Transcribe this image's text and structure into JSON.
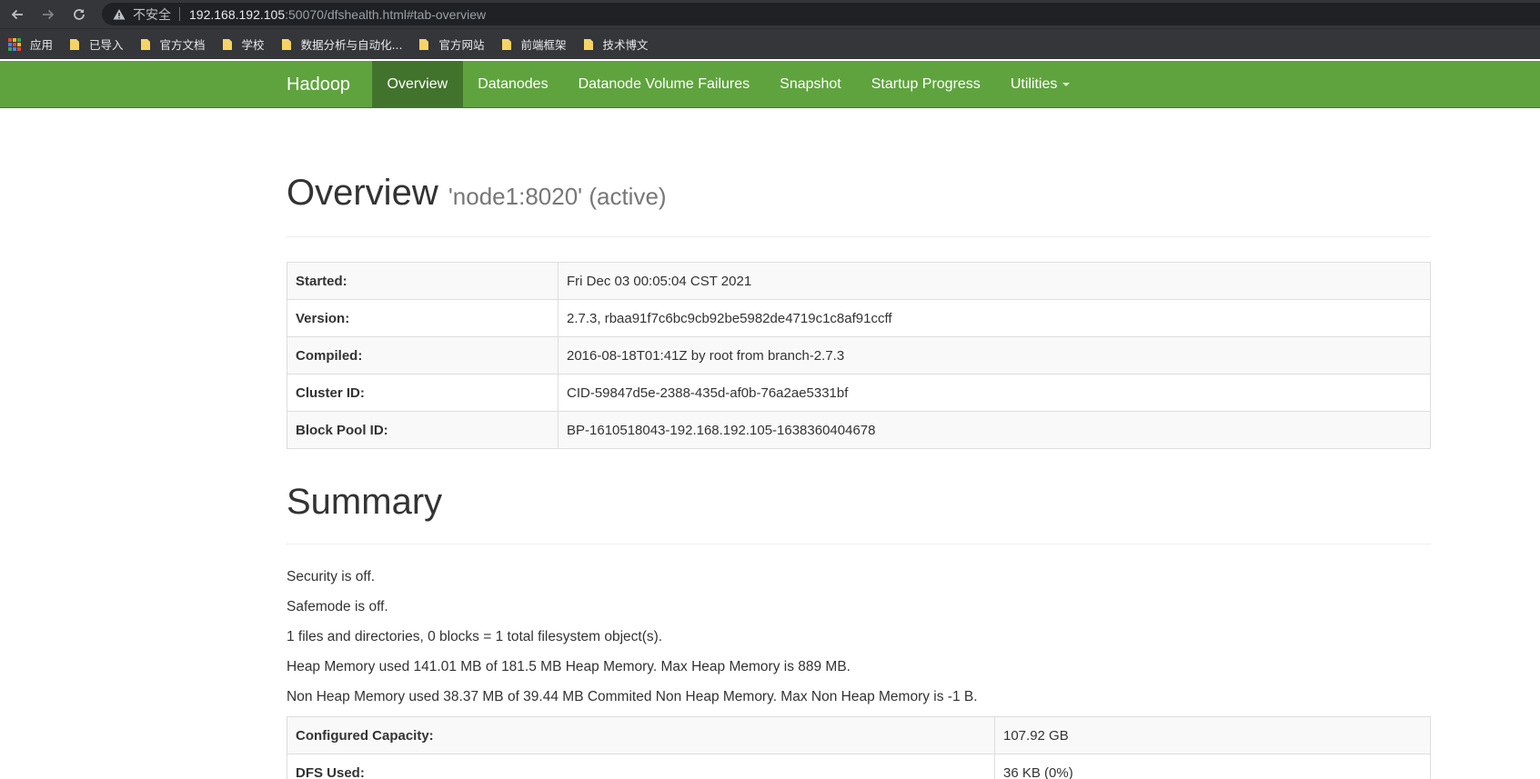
{
  "browser": {
    "insecure_label": "不安全",
    "url_host": "192.168.192.105",
    "url_rest": ":50070/dfshealth.html#tab-overview"
  },
  "bookmarks": {
    "apps_label": "应用",
    "items": [
      "已导入",
      "官方文档",
      "学校",
      "数据分析与自动化...",
      "官方网站",
      "前端框架",
      "技术博文"
    ]
  },
  "navbar": {
    "brand": "Hadoop",
    "items": [
      "Overview",
      "Datanodes",
      "Datanode Volume Failures",
      "Snapshot",
      "Startup Progress",
      "Utilities"
    ]
  },
  "overview": {
    "title": "Overview",
    "subtitle": "'node1:8020' (active)",
    "rows": [
      {
        "label": "Started:",
        "value": "Fri Dec 03 00:05:04 CST 2021"
      },
      {
        "label": "Version:",
        "value": "2.7.3, rbaa91f7c6bc9cb92be5982de4719c1c8af91ccff"
      },
      {
        "label": "Compiled:",
        "value": "2016-08-18T01:41Z by root from branch-2.7.3"
      },
      {
        "label": "Cluster ID:",
        "value": "CID-59847d5e-2388-435d-af0b-76a2ae5331bf"
      },
      {
        "label": "Block Pool ID:",
        "value": "BP-1610518043-192.168.192.105-1638360404678"
      }
    ]
  },
  "summary": {
    "title": "Summary",
    "lines": [
      "Security is off.",
      "Safemode is off.",
      "1 files and directories, 0 blocks = 1 total filesystem object(s).",
      "Heap Memory used 141.01 MB of 181.5 MB Heap Memory. Max Heap Memory is 889 MB.",
      "Non Heap Memory used 38.37 MB of 39.44 MB Commited Non Heap Memory. Max Non Heap Memory is -1 B."
    ],
    "rows": [
      {
        "label": "Configured Capacity:",
        "value": "107.92 GB"
      },
      {
        "label": "DFS Used:",
        "value": "36 KB (0%)"
      }
    ]
  },
  "colors": {
    "navbar": "#5fa33e",
    "navbar_active": "#42732c",
    "browser_chrome": "#35363a"
  }
}
